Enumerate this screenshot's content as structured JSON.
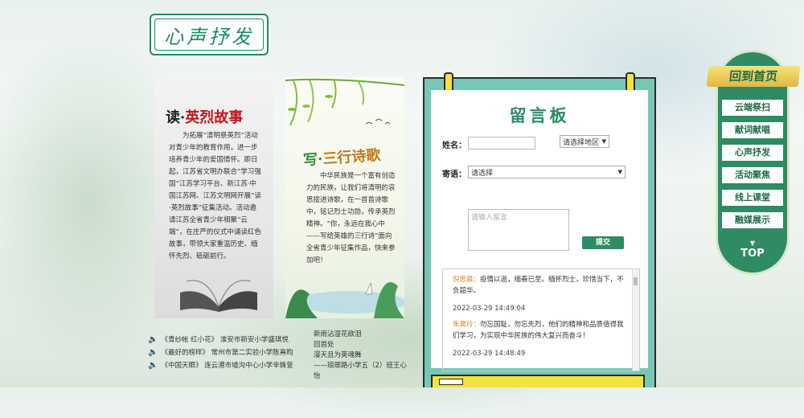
{
  "section": {
    "title": "心声抒发"
  },
  "cards": [
    {
      "title_prefix": "读·",
      "title_highlight": "英烈故事",
      "body": "为拓展“清明祭英烈”活动对青少年的教育作用，进一步培养青少年的爱国情怀。即日起，江苏省文明办联合“学习强国”江苏学习平台、新江苏·中国江苏网、江苏文明网开展“读·英烈故事”征集活动。活动邀请江苏全省青少年相聚“云端”，在庄严的仪式中诵读红色故事，带领大家重温历史、缅怀先烈、砥砺前行。"
    },
    {
      "title_prefix": "写·",
      "title_highlight": "三行诗歌",
      "body": "中华民族是一个富有创造力的民族，让我们将清明的哀思接进诗歌，在一首首诗歌中，铭记烈士功勋，传承英烈精神。“你，永远在我心中——写给英雄的三行诗”面向全省青少年征集作品，快来参加吧！"
    }
  ],
  "audio_list": [
    {
      "title": "《青纱帐 红小花》",
      "author": "淮安市新安小学盛琪悦"
    },
    {
      "title": "《最好的榜样》",
      "author": "常州市第二实验小学陈熹昀"
    },
    {
      "title": "《中国天眼》",
      "author": "连云港市墟沟中心小学辛姝萱"
    }
  ],
  "poem": {
    "lines": [
      "新雨沾湿花欲泪",
      "回首处",
      "漫天且为英魂舞"
    ],
    "author": "——琅琊路小学五（2）班王心怡"
  },
  "board": {
    "title": "留言板",
    "name_label": "姓名：",
    "name_value": "",
    "region_select": "请选择地区",
    "greeting_label": "寄语：",
    "greeting_select": "请选择",
    "message_placeholder": "请输入留言",
    "submit_label": "提交",
    "messages": [
      {
        "name": "倪思晨：",
        "text": "疫情以逝，缅春已至。缅怀烈士，珍惜当下，不负韶华。",
        "time": "2022-03-29 14:49:04"
      },
      {
        "name": "朱昊玲：",
        "text": "勿忘国耻，勿忘先烈，他们的精神和品质值得我们学习，为实现中华民族的伟大复兴而奋斗！",
        "time": "2022-03-29 14:48:49"
      }
    ]
  },
  "nav": {
    "home_label": "回到首页",
    "items": [
      "云端祭扫",
      "献词献唱",
      "心声抒发",
      "活动聚焦",
      "线上课堂",
      "融媒展示"
    ],
    "top_label": "TOP"
  },
  "colors": {
    "brand_green": "#2e8b62",
    "clip_yellow": "#f5e23a",
    "board_teal": "#78c7b6",
    "highlight_red": "#c0161d"
  }
}
